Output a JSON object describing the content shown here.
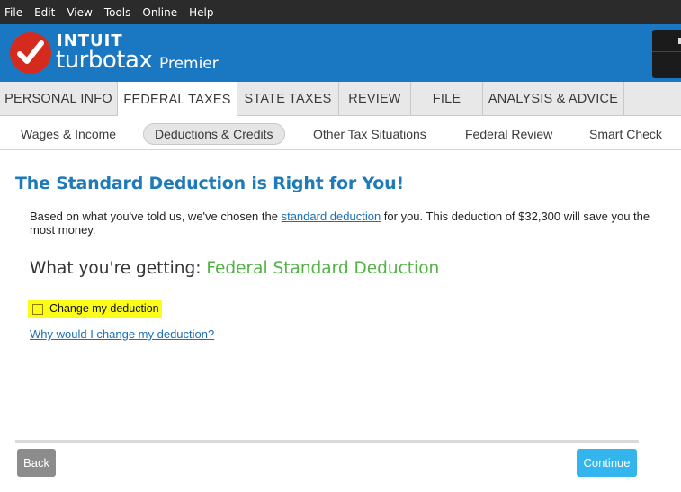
{
  "menu": [
    "File",
    "Edit",
    "View",
    "Tools",
    "Online",
    "Help"
  ],
  "brand": {
    "company": "INTUIT",
    "product": "turbotax",
    "edition": "Premier",
    "logo_color": "#d52b1e",
    "header_color": "#1a77c2"
  },
  "main_tabs": [
    {
      "label": "PERSONAL INFO",
      "active": false
    },
    {
      "label": "FEDERAL TAXES",
      "active": true
    },
    {
      "label": "STATE TAXES",
      "active": false
    },
    {
      "label": "REVIEW",
      "active": false
    },
    {
      "label": "FILE",
      "active": false
    },
    {
      "label": "ANALYSIS & ADVICE",
      "active": false
    }
  ],
  "sub_tabs": [
    {
      "label": "Wages & Income",
      "active": false
    },
    {
      "label": "Deductions & Credits",
      "active": true
    },
    {
      "label": "Other Tax Situations",
      "active": false
    },
    {
      "label": "Federal Review",
      "active": false
    },
    {
      "label": "Smart Check",
      "active": false
    }
  ],
  "content": {
    "title": "The Standard Deduction is Right for You!",
    "para_before": "Based on what you've told us, we've chosen the ",
    "para_link": "standard deduction",
    "para_after": " for you. This deduction of $32,300 will save you the most money.",
    "getting_label": "What you're getting: ",
    "getting_value": "Federal Standard Deduction",
    "checkbox_label": "Change my deduction",
    "checkbox_checked": false,
    "why_link": "Why would I change my deduction?"
  },
  "footer": {
    "back": "Back",
    "continue": "Continue"
  }
}
